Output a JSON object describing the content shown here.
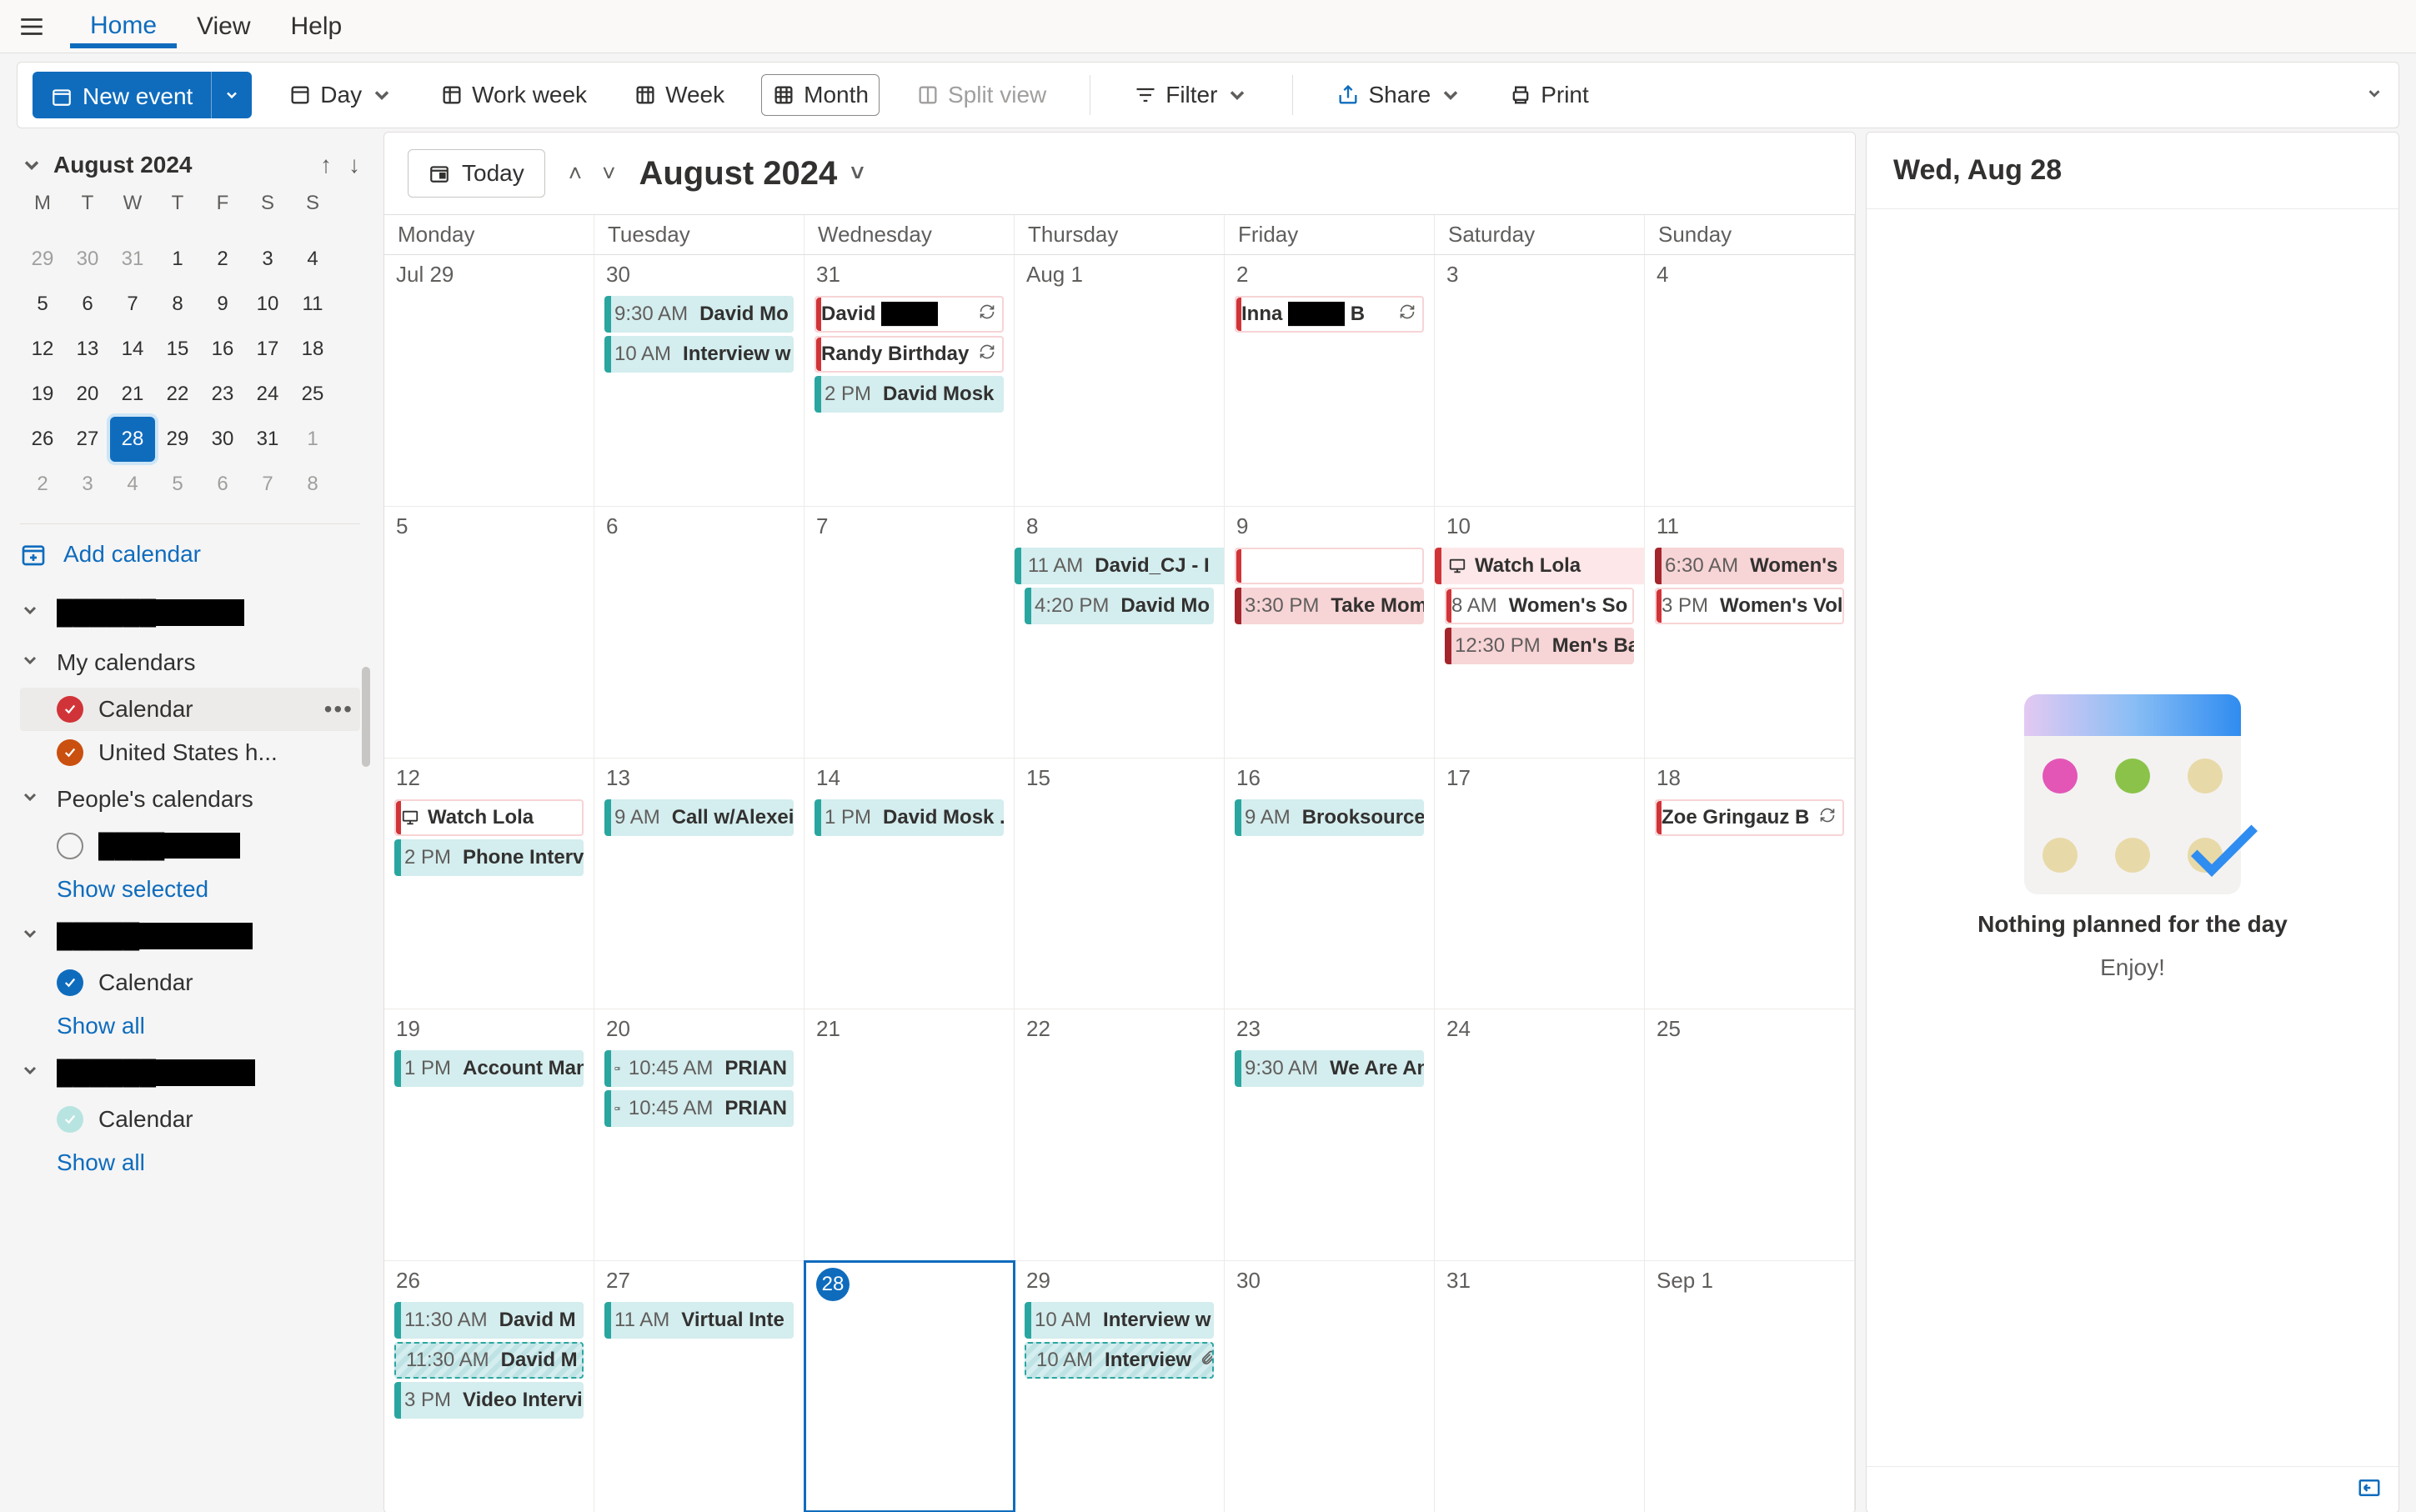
{
  "brand_accent": "#0f6cbd",
  "nav": {
    "tabs": [
      "Home",
      "View",
      "Help"
    ],
    "active": 0
  },
  "toolbar": {
    "new_event": "New event",
    "views": {
      "day": "Day",
      "workweek": "Work week",
      "week": "Week",
      "month": "Month",
      "split": "Split view"
    },
    "filter": "Filter",
    "share": "Share",
    "print": "Print"
  },
  "mini_calendar": {
    "title": "August 2024",
    "dow": [
      "M",
      "T",
      "W",
      "T",
      "F",
      "S",
      "S"
    ],
    "rows": [
      [
        {
          "d": "29",
          "o": true
        },
        {
          "d": "30",
          "o": true
        },
        {
          "d": "31",
          "o": true
        },
        {
          "d": "1"
        },
        {
          "d": "2"
        },
        {
          "d": "3"
        },
        {
          "d": "4"
        }
      ],
      [
        {
          "d": "5"
        },
        {
          "d": "6"
        },
        {
          "d": "7"
        },
        {
          "d": "8"
        },
        {
          "d": "9"
        },
        {
          "d": "10"
        },
        {
          "d": "11"
        }
      ],
      [
        {
          "d": "12"
        },
        {
          "d": "13"
        },
        {
          "d": "14"
        },
        {
          "d": "15"
        },
        {
          "d": "16"
        },
        {
          "d": "17"
        },
        {
          "d": "18"
        }
      ],
      [
        {
          "d": "19"
        },
        {
          "d": "20"
        },
        {
          "d": "21"
        },
        {
          "d": "22"
        },
        {
          "d": "23"
        },
        {
          "d": "24"
        },
        {
          "d": "25"
        }
      ],
      [
        {
          "d": "26"
        },
        {
          "d": "27"
        },
        {
          "d": "28",
          "today": true
        },
        {
          "d": "29"
        },
        {
          "d": "30"
        },
        {
          "d": "31"
        },
        {
          "d": "1",
          "o": true
        }
      ],
      [
        {
          "d": "2",
          "o": true
        },
        {
          "d": "3",
          "o": true
        },
        {
          "d": "4",
          "o": true
        },
        {
          "d": "5",
          "o": true
        },
        {
          "d": "6",
          "o": true
        },
        {
          "d": "7",
          "o": true
        },
        {
          "d": "8",
          "o": true
        }
      ]
    ]
  },
  "sidebar": {
    "add_calendar": "Add calendar",
    "accounts": [
      {
        "name_redacted": "██████@gma...",
        "sections": [
          {
            "title": "My calendars",
            "items": [
              {
                "label": "Calendar",
                "color": "red",
                "checked": true,
                "hover": true
              },
              {
                "label": "United States h...",
                "color": "orange",
                "checked": true
              }
            ]
          },
          {
            "title": "People's calendars",
            "items": [
              {
                "label_redacted": "████@gm...",
                "color": "empty"
              }
            ],
            "footer_link": "Show selected"
          }
        ]
      },
      {
        "name_redacted": "█████@hotmai...",
        "plain_items": [
          {
            "label": "Calendar",
            "color": "blue",
            "checked": true
          }
        ],
        "footer_link": "Show all"
      },
      {
        "name_redacted": "██████@gmail...",
        "plain_items": [
          {
            "label": "Calendar",
            "color": "teal",
            "checked": true
          }
        ],
        "footer_link": "Show all"
      }
    ]
  },
  "calendar_header": {
    "today": "Today",
    "title": "August 2024"
  },
  "dow": [
    "Monday",
    "Tuesday",
    "Wednesday",
    "Thursday",
    "Friday",
    "Saturday",
    "Sunday"
  ],
  "weeks": [
    [
      {
        "num": "Jul 29",
        "events": []
      },
      {
        "num": "30",
        "events": [
          {
            "time": "9:30 AM",
            "title": "David Mo",
            "style": "teal"
          },
          {
            "time": "10 AM",
            "title": "Interview w",
            "style": "teal"
          }
        ]
      },
      {
        "num": "31",
        "events": [
          {
            "title": "David ████",
            "style": "pink-outline",
            "recur": true
          },
          {
            "title": "Randy Birthday",
            "style": "pink-outline",
            "recur": true
          },
          {
            "time": "2 PM",
            "title": "David Mosk",
            "style": "teal"
          }
        ]
      },
      {
        "num": "Aug 1",
        "events": []
      },
      {
        "num": "2",
        "events": [
          {
            "title": "Inna ████ B",
            "style": "pink-outline",
            "recur": true
          }
        ]
      },
      {
        "num": "3",
        "events": []
      },
      {
        "num": "4",
        "events": []
      }
    ],
    [
      {
        "num": "5",
        "events": []
      },
      {
        "num": "6",
        "events": []
      },
      {
        "num": "7",
        "events": []
      },
      {
        "num": "8",
        "events": [
          {
            "time": "11 AM",
            "title": "David_CJ - I",
            "style": "teal",
            "span_right": true
          },
          {
            "time": "4:20 PM",
            "title": "David Mo",
            "style": "teal"
          }
        ]
      },
      {
        "num": "9",
        "events": [
          {
            "title": "",
            "style": "pink-outline",
            "tiny": true
          },
          {
            "time": "3:30 PM",
            "title": "Take Mom",
            "style": "red"
          }
        ]
      },
      {
        "num": "10",
        "events": [
          {
            "title": "Watch Lola",
            "style": "pink",
            "icon": "monitor",
            "span_right": true
          },
          {
            "time": "8 AM",
            "title": "Women's So",
            "style": "pink-outline"
          },
          {
            "time": "12:30 PM",
            "title": "Men's Ba",
            "style": "red"
          }
        ]
      },
      {
        "num": "11",
        "events": [
          {
            "title": "",
            "style": "pink",
            "cont": true
          },
          {
            "time": "6:30 AM",
            "title": "Women's",
            "style": "red"
          },
          {
            "time": "3 PM",
            "title": "Women's Vol",
            "style": "pink-outline"
          }
        ]
      }
    ],
    [
      {
        "num": "12",
        "events": [
          {
            "title": "Watch Lola",
            "style": "pink-outline",
            "icon": "monitor"
          },
          {
            "time": "2 PM",
            "title": "Phone Interv",
            "style": "teal"
          }
        ]
      },
      {
        "num": "13",
        "events": [
          {
            "time": "9 AM",
            "title": "Call w/Alexei",
            "style": "teal"
          }
        ]
      },
      {
        "num": "14",
        "events": [
          {
            "time": "1 PM",
            "title": "David Mosk .",
            "style": "teal"
          }
        ]
      },
      {
        "num": "15",
        "events": []
      },
      {
        "num": "16",
        "events": [
          {
            "time": "9 AM",
            "title": "Brooksource",
            "style": "teal"
          }
        ]
      },
      {
        "num": "17",
        "events": []
      },
      {
        "num": "18",
        "events": [
          {
            "title": "Zoe Gringauz B",
            "style": "pink-outline",
            "recur": true
          }
        ]
      }
    ],
    [
      {
        "num": "19",
        "events": [
          {
            "time": "1 PM",
            "title": "Account Man",
            "style": "teal"
          }
        ]
      },
      {
        "num": "20",
        "events": [
          {
            "time": "10:45 AM",
            "title": "PRIAN",
            "style": "teal",
            "icon": "camera"
          },
          {
            "time": "10:45 AM",
            "title": "PRIAN",
            "style": "teal",
            "icon": "camera"
          }
        ]
      },
      {
        "num": "21",
        "events": []
      },
      {
        "num": "22",
        "events": []
      },
      {
        "num": "23",
        "events": [
          {
            "time": "9:30 AM",
            "title": "We Are An",
            "style": "teal"
          }
        ]
      },
      {
        "num": "24",
        "events": []
      },
      {
        "num": "25",
        "events": []
      }
    ],
    [
      {
        "num": "26",
        "events": [
          {
            "time": "11:30 AM",
            "title": "David M",
            "style": "teal"
          },
          {
            "time": "11:30 AM",
            "title": "David M",
            "style": "hatched"
          },
          {
            "time": "3 PM",
            "title": "Video Intervi",
            "style": "teal"
          }
        ]
      },
      {
        "num": "27",
        "events": [
          {
            "time": "11 AM",
            "title": "Virtual Inte",
            "style": "teal"
          }
        ]
      },
      {
        "num": "28",
        "today": true,
        "events": []
      },
      {
        "num": "29",
        "events": [
          {
            "time": "10 AM",
            "title": "Interview w",
            "style": "teal"
          },
          {
            "time": "10 AM",
            "title": "Interview",
            "style": "hatched",
            "clip": true
          }
        ]
      },
      {
        "num": "30",
        "events": []
      },
      {
        "num": "31",
        "events": []
      },
      {
        "num": "Sep 1",
        "events": []
      }
    ]
  ],
  "rightpane": {
    "title": "Wed, Aug 28",
    "empty_title": "Nothing planned for the day",
    "empty_sub": "Enjoy!"
  }
}
